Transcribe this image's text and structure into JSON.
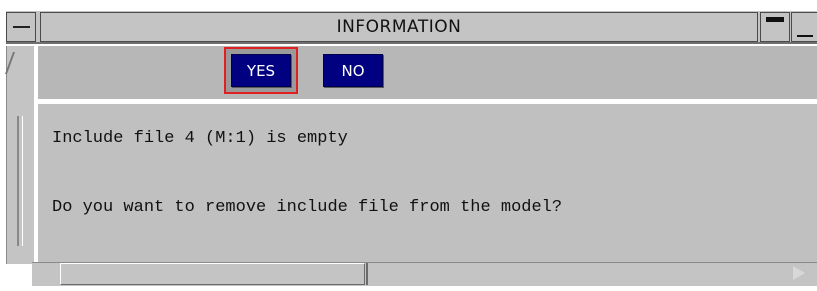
{
  "window": {
    "title": "INFORMATION"
  },
  "buttons": {
    "yes_label": "YES",
    "no_label": "NO"
  },
  "message": {
    "line1": "Include file 4 (M:1) is empty",
    "line2": "Do you want to remove include file from the model?"
  },
  "colors": {
    "button_bg": "#000080",
    "focus_outline": "#e02020",
    "panel_bg": "#c0c0c0"
  }
}
